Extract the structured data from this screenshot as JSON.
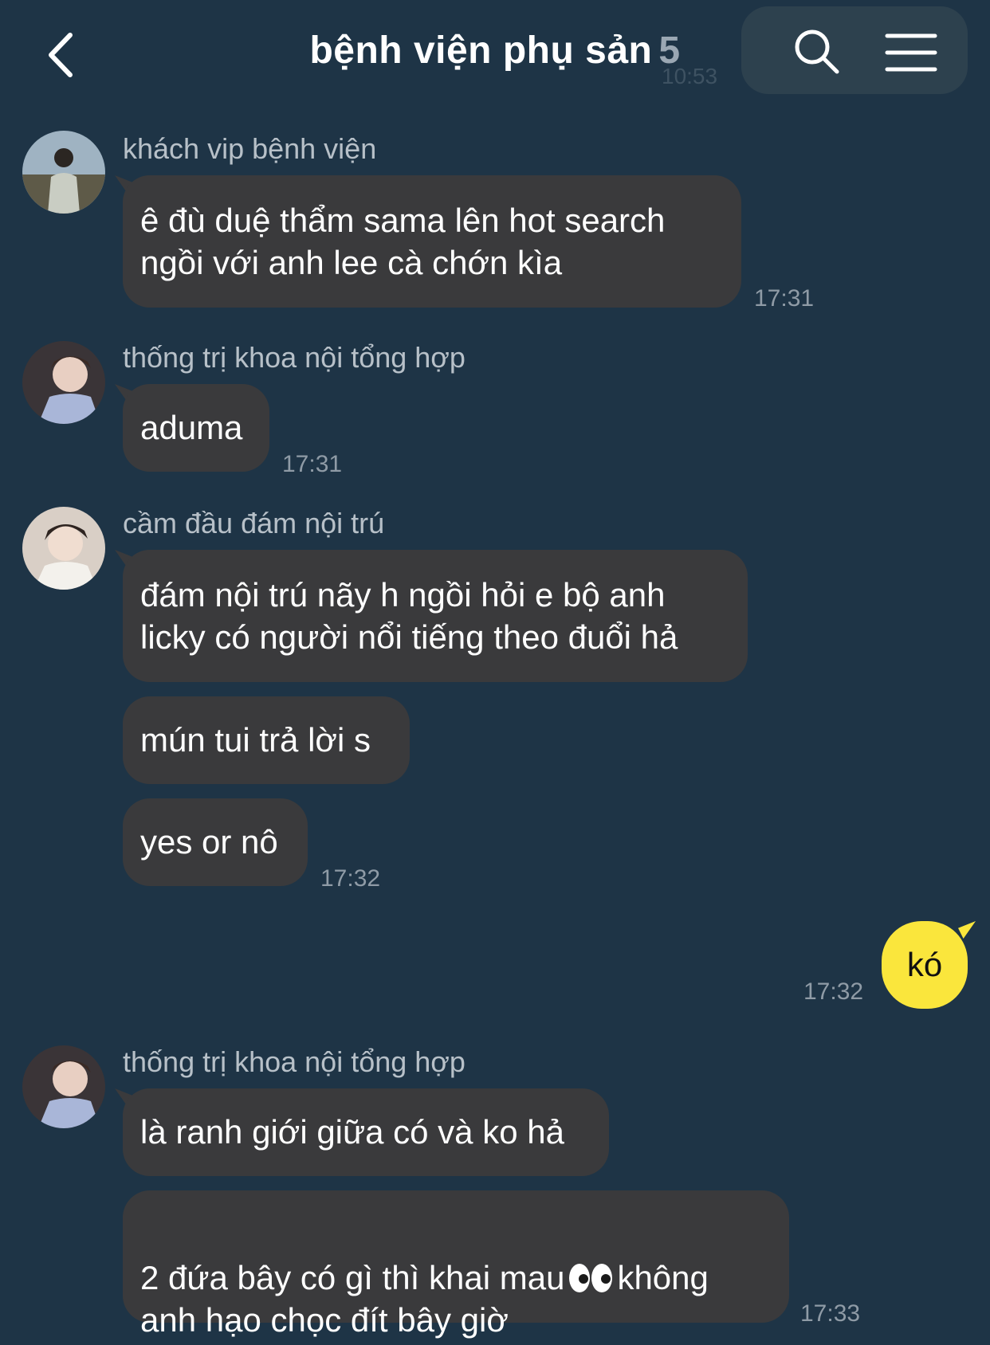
{
  "header": {
    "title": "bệnh viện phụ sản",
    "member_count": "5",
    "ghost_time": "10:53"
  },
  "icons": {
    "back": "chevron-left-icon",
    "search": "search-icon",
    "menu": "hamburger-menu-icon"
  },
  "colors": {
    "background": "#1e3446",
    "incoming_bubble": "#3a3a3c",
    "outgoing_bubble": "#fae63c",
    "sender_text": "#b7c0c8",
    "timestamp": "#8f9ba6"
  },
  "messages": [
    {
      "sender": "khách vip bệnh viện",
      "bubbles": [
        "ê đù duệ thẩm sama lên hot search\nngồi với anh lee cà chớn kìa"
      ],
      "time": "17:31"
    },
    {
      "sender": "thống trị khoa nội tổng hợp",
      "bubbles": [
        "aduma"
      ],
      "time": "17:31"
    },
    {
      "sender": "cầm đầu đám nội trú",
      "bubbles": [
        "đám nội trú nãy h ngồi hỏi e bộ anh\nlicky có người nổi tiếng theo đuổi hả",
        "mún tui trả lời s",
        "yes or nô"
      ],
      "time": "17:32"
    },
    {
      "sender": "me",
      "bubbles": [
        "kó"
      ],
      "time": "17:32"
    },
    {
      "sender": "thống trị khoa nội tổng hợp",
      "bubbles": [
        "là ranh giới giữa có và ko hả",
        "2 đứa bây có gì thì khai mau",
        "không\nanh hạo chọc đít bây giờ"
      ],
      "time": "17:33"
    }
  ]
}
